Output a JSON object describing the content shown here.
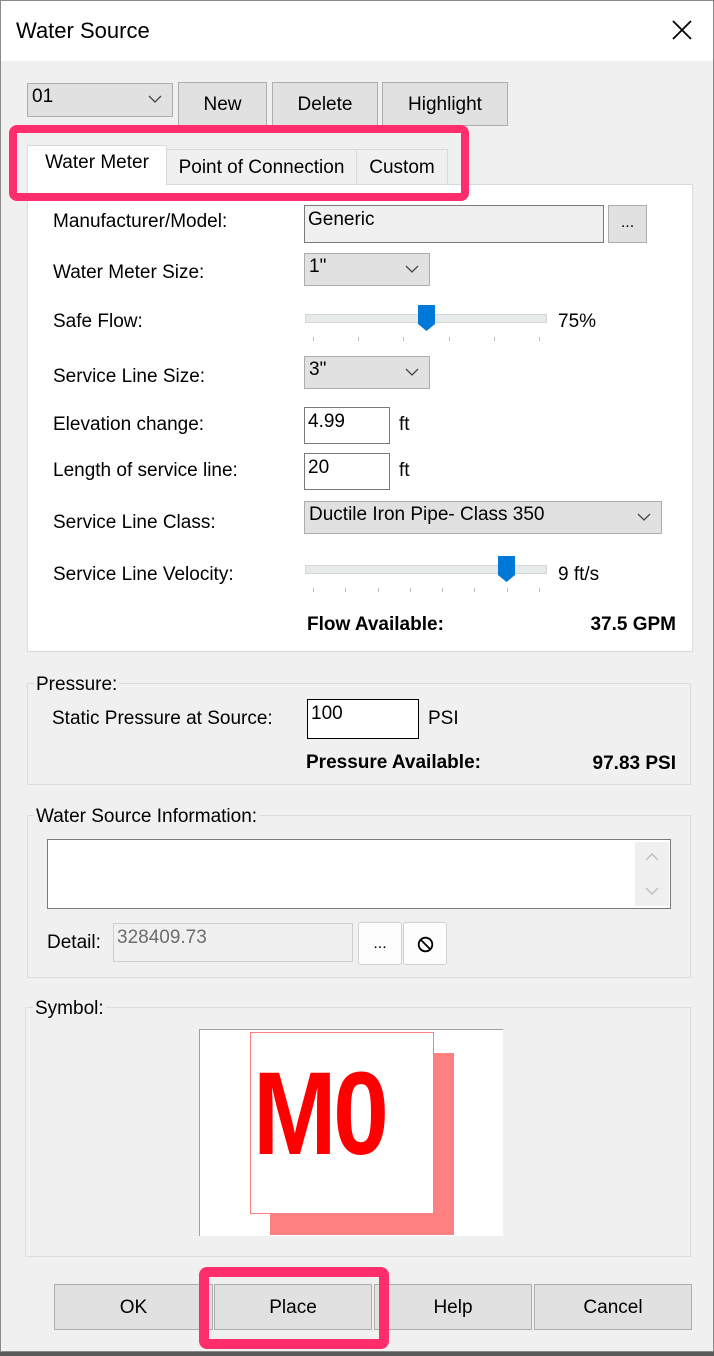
{
  "window": {
    "title": "Water Source",
    "close_icon": "close-icon"
  },
  "toolbar": {
    "source_select": "01",
    "new_label": "New",
    "delete_label": "Delete",
    "highlight_label": "Highlight"
  },
  "tabs": [
    {
      "label": "Water Meter",
      "active": true
    },
    {
      "label": "Point of Connection",
      "active": false
    },
    {
      "label": "Custom",
      "active": false
    }
  ],
  "water_meter": {
    "manufacturer_label": "Manufacturer/Model:",
    "manufacturer_value": "Generic",
    "browse_label": "...",
    "meter_size_label": "Water Meter Size:",
    "meter_size_value": "1\"",
    "safe_flow_label": "Safe Flow:",
    "safe_flow_value": "75%",
    "safe_flow_fraction": 0.5,
    "service_line_size_label": "Service Line Size:",
    "service_line_size_value": "3\"",
    "elevation_label": "Elevation change:",
    "elevation_value": "4.99",
    "elevation_unit": "ft",
    "length_label": "Length of service line:",
    "length_value": "20",
    "length_unit": "ft",
    "class_label": "Service Line Class:",
    "class_value": "Ductile Iron Pipe- Class 350",
    "velocity_label": "Service Line Velocity:",
    "velocity_value": "9 ft/s",
    "velocity_fraction": 0.857,
    "flow_available_label": "Flow Available:",
    "flow_available_value": "37.5 GPM"
  },
  "pressure": {
    "group_label": "Pressure:",
    "static_label": "Static Pressure at Source:",
    "static_value": "100",
    "static_unit": "PSI",
    "available_label": "Pressure Available:",
    "available_value": "97.83 PSI"
  },
  "info": {
    "group_label": "Water Source Information:",
    "text_value": "",
    "detail_label": "Detail:",
    "detail_value": "328409.73",
    "browse_label": "...",
    "clear_icon": "no-symbol-icon"
  },
  "symbol": {
    "group_label": "Symbol:",
    "text": "M0",
    "text_color": "#ff0000",
    "shadow_color": "#ff8080"
  },
  "footer": {
    "ok_label": "OK",
    "place_label": "Place",
    "help_label": "Help",
    "cancel_label": "Cancel"
  },
  "annotation_color": "#ff2d6b",
  "slider_color": "#0078d7"
}
